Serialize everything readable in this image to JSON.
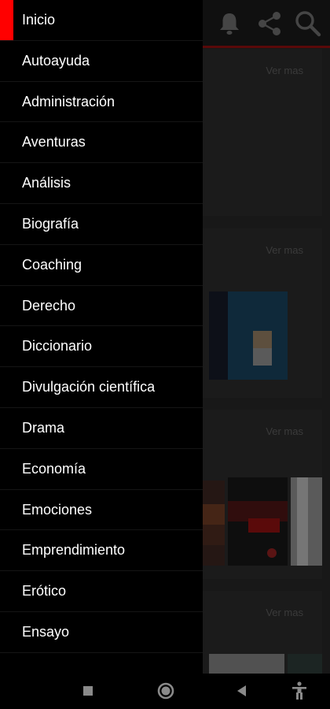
{
  "drawer": {
    "items": [
      {
        "label": "Inicio"
      },
      {
        "label": "Autoayuda"
      },
      {
        "label": "Administración"
      },
      {
        "label": "Aventuras"
      },
      {
        "label": "Análisis"
      },
      {
        "label": "Biografía"
      },
      {
        "label": "Coaching"
      },
      {
        "label": "Derecho"
      },
      {
        "label": "Diccionario"
      },
      {
        "label": "Divulgación científica"
      },
      {
        "label": "Drama"
      },
      {
        "label": "Economía"
      },
      {
        "label": "Emociones"
      },
      {
        "label": "Emprendimiento"
      },
      {
        "label": "Erótico"
      },
      {
        "label": "Ensayo"
      }
    ],
    "active_index": 0
  },
  "background": {
    "sections": [
      {
        "ver_mas": "Ver mas"
      },
      {
        "ver_mas": "Ver mas"
      },
      {
        "ver_mas": "Ver mas"
      },
      {
        "ver_mas": "Ver mas"
      }
    ]
  },
  "topbar": {
    "icons": [
      "bell-icon",
      "share-icon",
      "search-icon"
    ]
  },
  "system_nav": {
    "icons": [
      "recents-square-icon",
      "home-circle-icon",
      "back-triangle-icon",
      "accessibility-icon"
    ]
  },
  "colors": {
    "accent": "#ff0000",
    "drawer_bg": "#000000",
    "topbar_border": "#8b0f0f"
  }
}
